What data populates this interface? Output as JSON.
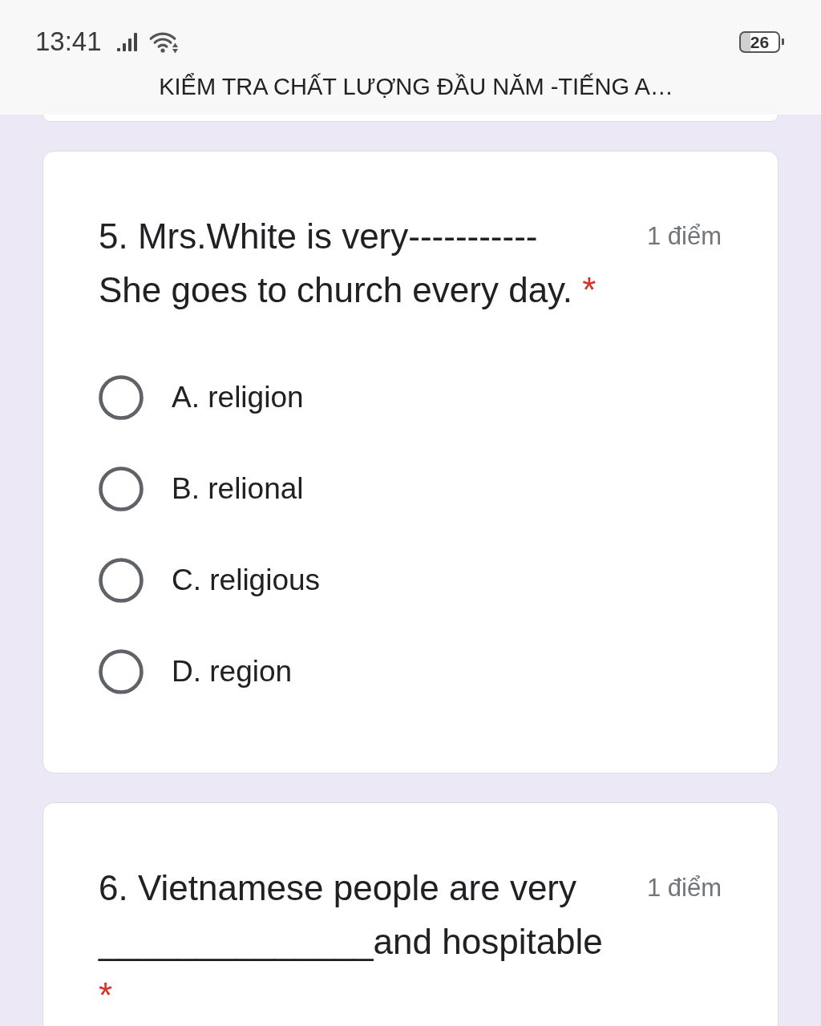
{
  "status_bar": {
    "time": "13:41",
    "battery": "26"
  },
  "header": {
    "title": "KIỂM TRA CHẤT LƯỢNG ĐẦU NĂM -TIẾNG A…"
  },
  "questions": [
    {
      "title": "5. Mrs.White is very----------- She goes to church every day.",
      "required_mark": "*",
      "points": "1 điểm",
      "options": [
        {
          "label": "A. religion",
          "selected": false
        },
        {
          "label": "B. relional",
          "selected": false
        },
        {
          "label": "C. religious",
          "selected": false
        },
        {
          "label": "D. region",
          "selected": false
        }
      ]
    },
    {
      "title": "6. Vietnamese people are very ______________and hospitable",
      "required_mark": "*",
      "points": "1 điểm"
    }
  ]
}
